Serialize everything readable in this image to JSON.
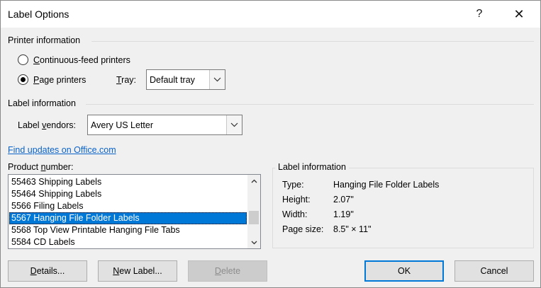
{
  "window": {
    "title": "Label Options",
    "help": "?",
    "close": "✕"
  },
  "printer_info": {
    "heading": "Printer information",
    "continuous": {
      "label": "Continuous-feed printers",
      "checked": false
    },
    "page": {
      "label": "Page printers",
      "checked": true
    },
    "tray_label": "Tray:",
    "tray_value": "Default tray"
  },
  "label_info": {
    "heading": "Label information",
    "vendors_label": "Label vendors:",
    "vendors_value": "Avery US Letter"
  },
  "link": "Find updates on Office.com",
  "product": {
    "heading": "Product number:",
    "items": [
      "55463 Shipping Labels",
      "55464 Shipping Labels",
      "5566 Filing Labels",
      "5567 Hanging File Folder Labels",
      "5568 Top View Printable Hanging File Tabs",
      "5584 CD Labels"
    ],
    "selected_index": 3
  },
  "details_box": {
    "heading": "Label information",
    "type_label": "Type:",
    "type_value": "Hanging File Folder Labels",
    "height_label": "Height:",
    "height_value": "2.07\"",
    "width_label": "Width:",
    "width_value": "1.19\"",
    "pagesize_label": "Page size:",
    "pagesize_value": "8.5\" × 11\""
  },
  "buttons": {
    "details": "Details...",
    "new_label": "New Label...",
    "delete": "Delete",
    "ok": "OK",
    "cancel": "Cancel"
  }
}
